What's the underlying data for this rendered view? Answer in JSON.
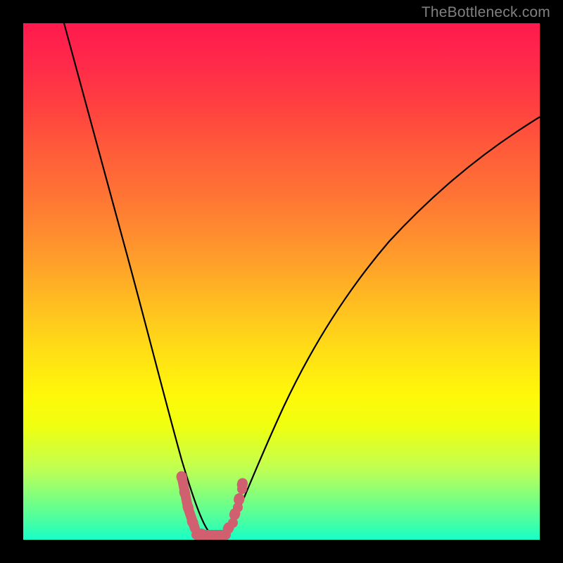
{
  "watermark": "TheBottleneck.com",
  "chart_data": {
    "type": "line",
    "title": "",
    "xlabel": "",
    "ylabel": "",
    "xlim": [
      0,
      100
    ],
    "ylim": [
      0,
      100
    ],
    "series": [
      {
        "name": "bottleneck-curve",
        "x": [
          8,
          12,
          16,
          20,
          24,
          27,
          29,
          31,
          33,
          34.5,
          36,
          37,
          38,
          40,
          43,
          48,
          55,
          62,
          70,
          78,
          86,
          94,
          100
        ],
        "y": [
          100,
          86,
          71,
          56,
          40,
          26,
          16,
          8,
          3,
          1,
          0.5,
          0.5,
          1,
          3,
          8,
          16,
          26,
          36,
          45,
          53,
          60,
          66,
          71
        ]
      },
      {
        "name": "highlight-region",
        "x": [
          30,
          31,
          32,
          33,
          34,
          35,
          36,
          37,
          38,
          39,
          40,
          41
        ],
        "y": [
          11,
          7,
          4,
          2,
          1,
          0.8,
          0.8,
          1,
          2,
          4,
          7,
          11
        ]
      }
    ],
    "gradient_stops": [
      {
        "pos": 0,
        "color": "#ff1a4d"
      },
      {
        "pos": 50,
        "color": "#ffc41f"
      },
      {
        "pos": 80,
        "color": "#e8ff20"
      },
      {
        "pos": 100,
        "color": "#1affc8"
      }
    ]
  }
}
